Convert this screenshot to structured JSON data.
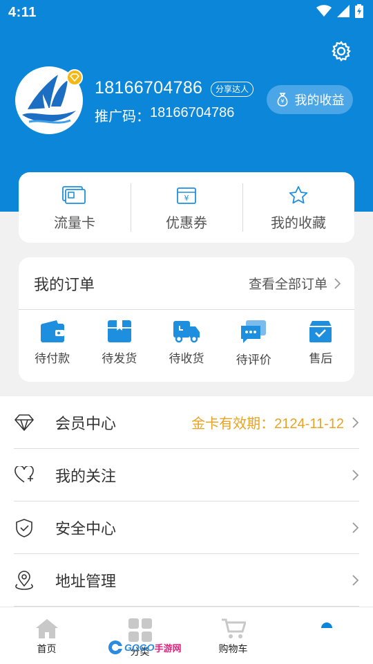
{
  "status_bar": {
    "time": "4:11"
  },
  "profile": {
    "phone": "18166704786",
    "tag": "分享达人",
    "promo_label": "推广码：",
    "promo_code": "18166704786",
    "earnings_label": "我的收益"
  },
  "quick_links": [
    {
      "label": "流量卡",
      "icon": "sim-card-icon"
    },
    {
      "label": "优惠券",
      "icon": "coupon-icon"
    },
    {
      "label": "我的收藏",
      "icon": "star-icon"
    }
  ],
  "orders": {
    "title": "我的订单",
    "view_all": "查看全部订单",
    "items": [
      {
        "label": "待付款",
        "icon": "wallet-icon"
      },
      {
        "label": "待发货",
        "icon": "box-icon"
      },
      {
        "label": "待收货",
        "icon": "truck-icon"
      },
      {
        "label": "待评价",
        "icon": "chat-icon"
      },
      {
        "label": "售后",
        "icon": "after-sale-icon"
      }
    ]
  },
  "menu": [
    {
      "label": "会员中心",
      "extra": "金卡有效期：2124-11-12",
      "icon": "diamond-icon"
    },
    {
      "label": "我的关注",
      "extra": "",
      "icon": "heart-plus-icon"
    },
    {
      "label": "安全中心",
      "extra": "",
      "icon": "shield-icon"
    },
    {
      "label": "地址管理",
      "extra": "",
      "icon": "location-icon"
    }
  ],
  "tabbar": [
    {
      "label": "首页",
      "icon": "home-icon"
    },
    {
      "label": "分类",
      "icon": "grid-icon"
    },
    {
      "label": "购物车",
      "icon": "cart-icon"
    },
    {
      "label": "",
      "icon": "user-icon"
    }
  ],
  "watermark": {
    "brand": "GOGO",
    "site": "手游网"
  },
  "colors": {
    "primary": "#0c86d9",
    "accent": "#e7a323",
    "icon_blue": "#1e8fde"
  }
}
